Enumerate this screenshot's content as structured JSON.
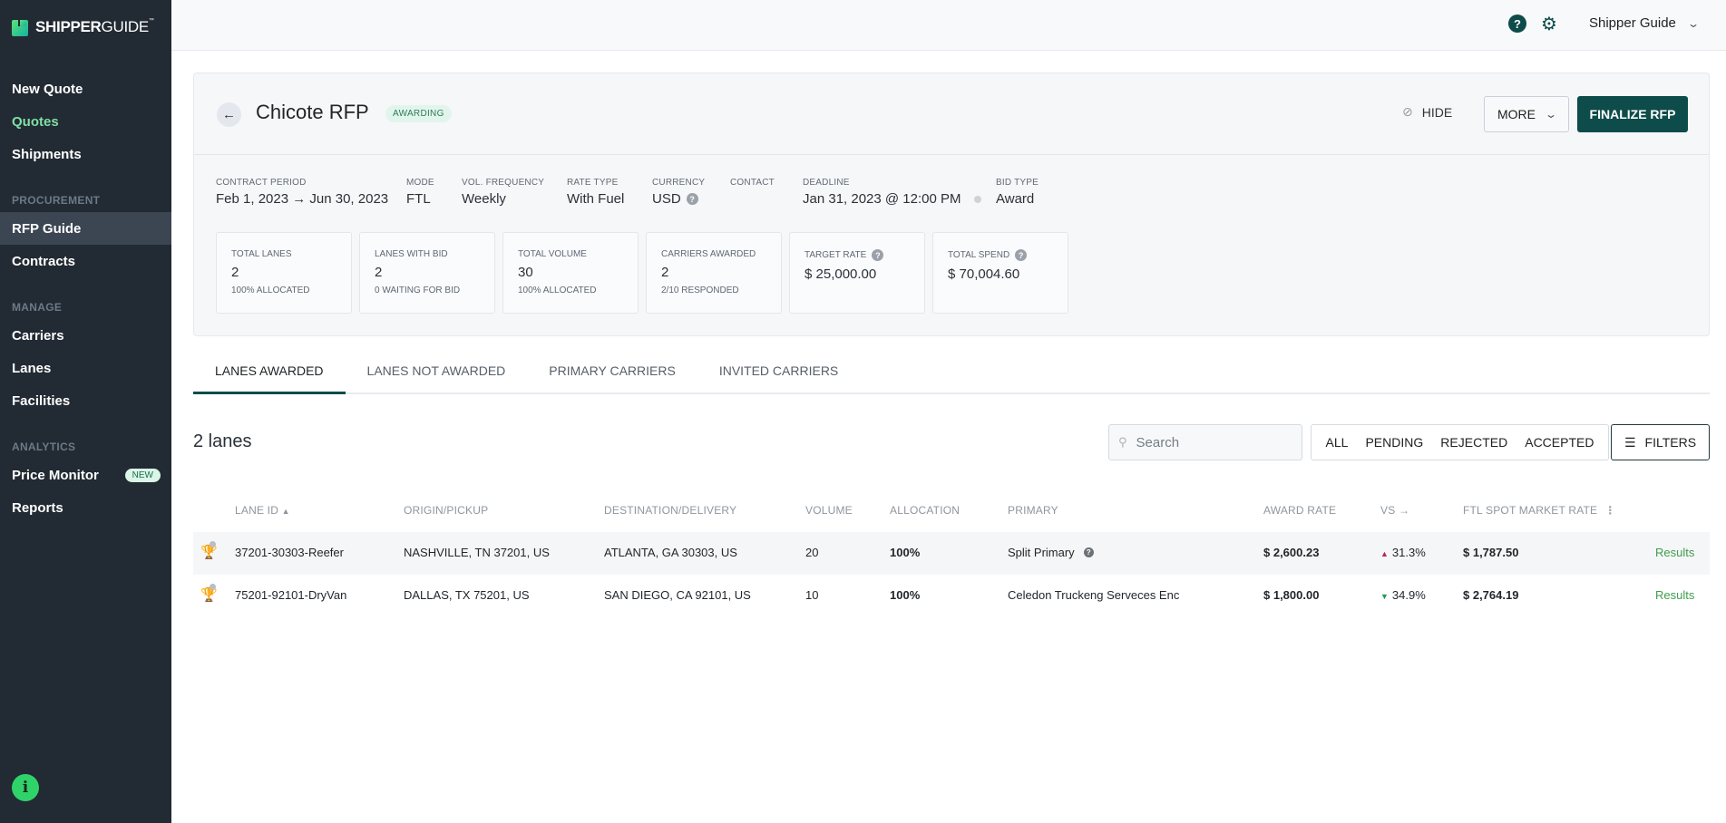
{
  "brand": {
    "bold": "SHIPPER",
    "light": "GUIDE",
    "tm": "™"
  },
  "sidebar": {
    "items": [
      {
        "label": "New Quote"
      },
      {
        "label": "Quotes"
      },
      {
        "label": "Shipments"
      }
    ],
    "procurement": {
      "title": "PROCUREMENT",
      "items": [
        {
          "label": "RFP Guide"
        },
        {
          "label": "Contracts"
        }
      ]
    },
    "manage": {
      "title": "MANAGE",
      "items": [
        {
          "label": "Carriers"
        },
        {
          "label": "Lanes"
        },
        {
          "label": "Facilities"
        }
      ]
    },
    "analytics": {
      "title": "ANALYTICS",
      "items": [
        {
          "label": "Price Monitor",
          "badge": "NEW"
        },
        {
          "label": "Reports"
        }
      ]
    },
    "info_icon": "i"
  },
  "topbar": {
    "help_icon": "?",
    "settings_icon": "⚙",
    "user": "Shipper Guide"
  },
  "rfp": {
    "back_icon": "←",
    "title": "Chicote RFP",
    "status": "AWARDING",
    "hide_label": "HIDE",
    "more_label": "MORE",
    "finalize_label": "FINALIZE RFP",
    "meta": {
      "contract_period": {
        "label": "CONTRACT PERIOD",
        "value": "Feb 1, 2023 → Jun 30, 2023"
      },
      "mode": {
        "label": "MODE",
        "value": "FTL"
      },
      "vol_frequency": {
        "label": "VOL. FREQUENCY",
        "value": "Weekly"
      },
      "rate_type": {
        "label": "RATE TYPE",
        "value": "With Fuel"
      },
      "currency": {
        "label": "CURRENCY",
        "value": "USD"
      },
      "contact": {
        "label": "CONTACT",
        "value": ""
      },
      "deadline": {
        "label": "DEADLINE",
        "value": "Jan 31, 2023 @ 12:00 PM"
      },
      "bid_type": {
        "label": "BID TYPE",
        "value": "Award"
      }
    },
    "stats": [
      {
        "label": "TOTAL LANES",
        "value": "2",
        "sub": "100% ALLOCATED"
      },
      {
        "label": "LANES WITH BID",
        "value": "2",
        "sub": "0 WAITING FOR BID"
      },
      {
        "label": "TOTAL VOLUME",
        "value": "30",
        "sub": "100% ALLOCATED"
      },
      {
        "label": "CARRIERS AWARDED",
        "value": "2",
        "sub": "2/10 RESPONDED"
      },
      {
        "label": "TARGET RATE",
        "value": "$ 25,000.00",
        "sub": ""
      },
      {
        "label": "TOTAL SPEND",
        "value": "$ 70,004.60",
        "sub": ""
      }
    ]
  },
  "tabs": [
    {
      "label": "LANES AWARDED",
      "active": true
    },
    {
      "label": "LANES NOT AWARDED"
    },
    {
      "label": "PRIMARY CARRIERS"
    },
    {
      "label": "INVITED CARRIERS"
    }
  ],
  "toolbar": {
    "count": "2 lanes",
    "search_placeholder": "Search",
    "segments": [
      "ALL",
      "PENDING",
      "REJECTED",
      "ACCEPTED"
    ],
    "filters_label": "FILTERS"
  },
  "table": {
    "columns": [
      "LANE ID",
      "ORIGIN/PICKUP",
      "DESTINATION/DELIVERY",
      "VOLUME",
      "ALLOCATION",
      "PRIMARY",
      "AWARD RATE",
      "VS →",
      "FTL SPOT MARKET RATE"
    ],
    "rows": [
      {
        "lane_id": "37201-30303-Reefer",
        "origin": "NASHVILLE, TN 37201, US",
        "destination": "ATLANTA, GA 30303, US",
        "volume": "20",
        "allocation": "100%",
        "primary": "Split Primary",
        "award_rate": "$ 2,600.23",
        "vs": "31.3%",
        "vs_dir": "up",
        "spot": "$ 1,787.50",
        "action": "Results"
      },
      {
        "lane_id": "75201-92101-DryVan",
        "origin": "DALLAS, TX 75201, US",
        "destination": "SAN DIEGO, CA 92101, US",
        "volume": "10",
        "allocation": "100%",
        "primary": "Celedon Truckeng Serveces Enc",
        "award_rate": "$ 1,800.00",
        "vs": "34.9%",
        "vs_dir": "down",
        "spot": "$ 2,764.19",
        "action": "Results"
      }
    ]
  },
  "colors": {
    "brand_dark": "#0d4c4a",
    "sidebar_bg": "#222a33",
    "up": "#c2224d",
    "down": "#1f9a4b",
    "link": "#3f9d4d"
  }
}
